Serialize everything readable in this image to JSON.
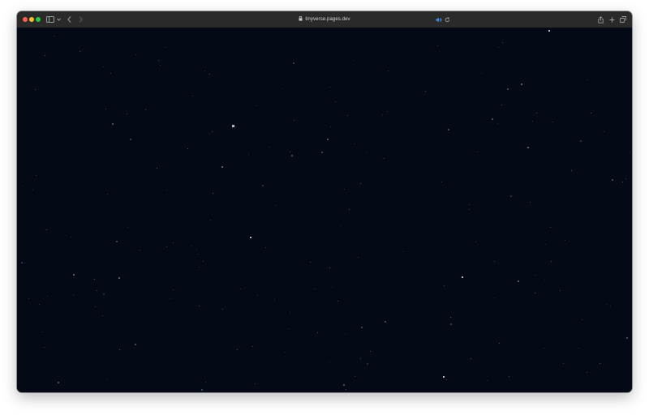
{
  "browser": {
    "url": "tinyverse.pages.dev",
    "colors": {
      "close": "#ff5f57",
      "minimize": "#febc2e",
      "zoom": "#28c840",
      "toolbar": "#2a2a2b",
      "background": "#040a15",
      "star": "#6f7f94",
      "bright_star": "#aab8c8"
    }
  },
  "icons": {
    "sidebar": "sidebar-icon",
    "back": "chevron-left-icon",
    "forward": "chevron-right-icon",
    "audio": "speaker-icon",
    "reload": "reload-icon",
    "share": "share-icon",
    "new_tab": "plus-icon",
    "tabs": "tab-overview-icon"
  }
}
